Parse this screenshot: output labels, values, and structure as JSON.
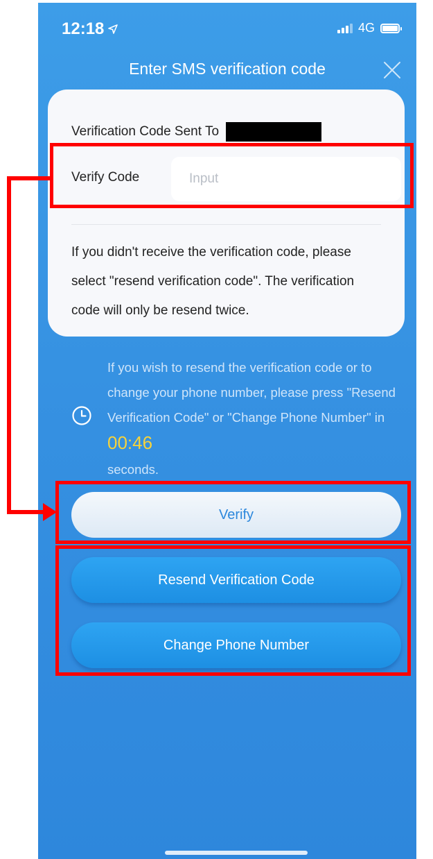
{
  "status_bar": {
    "time": "12:18",
    "network": "4G"
  },
  "header": {
    "title": "Enter SMS verification code"
  },
  "card": {
    "sent_to_label": "Verification Code Sent To",
    "verify_code_label": "Verify Code",
    "verify_code_placeholder": "Input",
    "verify_code_value": "",
    "note": "If you didn't receive the verification code, please select \"resend verification code\". The verification code will only be resend twice."
  },
  "notice": {
    "text_before": "If you wish to resend the verification code or to change your phone number, please press \"Resend Verification Code\" or \"Change Phone Number\" in",
    "countdown": "00:46",
    "text_after": "seconds."
  },
  "buttons": {
    "verify": "Verify",
    "resend": "Resend Verification Code",
    "change_phone": "Change Phone Number"
  },
  "colors": {
    "background_blue": "#3590e1",
    "card_background": "#f7f8fb",
    "countdown_yellow": "#f7d33b",
    "annotation_red": "#ff0000",
    "button_blue": "#1d8fe3"
  },
  "icons": {
    "status_location": "location-arrow-icon",
    "status_signal": "signal-bars-icon",
    "status_battery": "battery-icon",
    "close": "close-icon",
    "clock": "clock-icon"
  }
}
